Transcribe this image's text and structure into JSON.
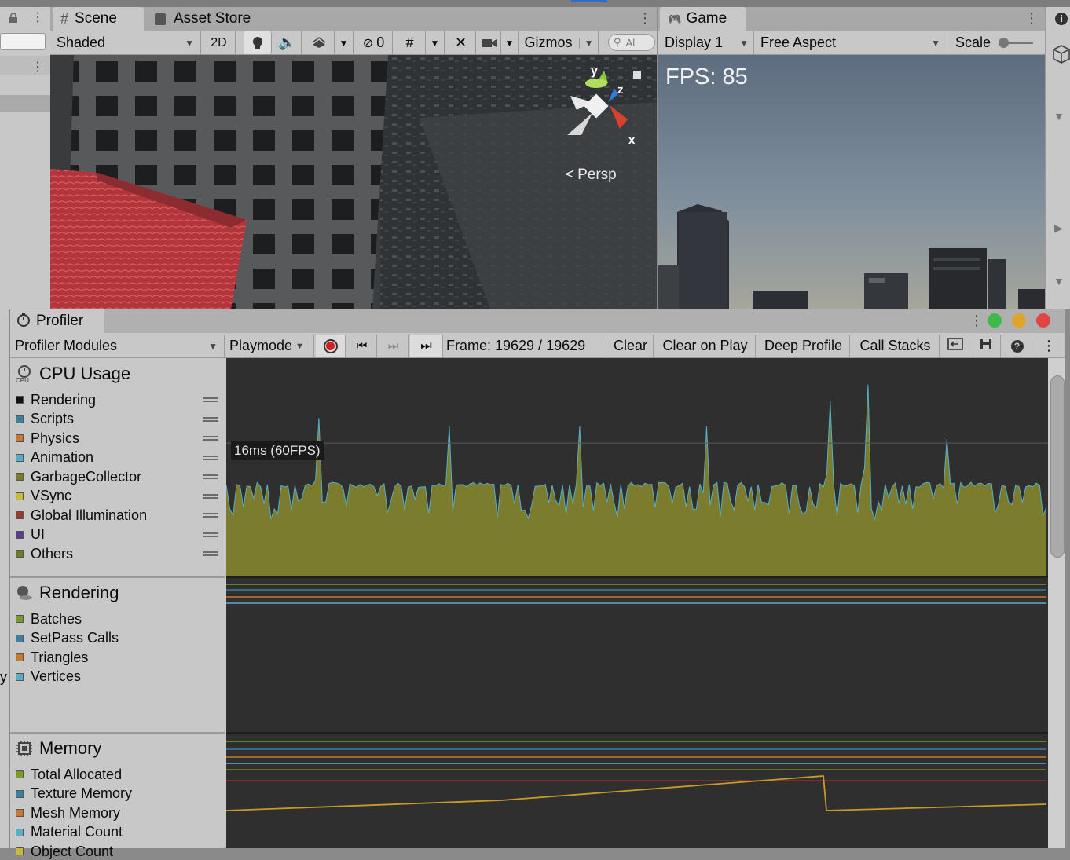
{
  "left_panel": {
    "lock_icon": "lock-icon",
    "menu_icon": "kebab-menu-icon"
  },
  "scene": {
    "tabs": [
      {
        "label": "Scene",
        "icon": "hash-icon"
      },
      {
        "label": "Asset Store",
        "icon": "shopping-bag-icon"
      }
    ],
    "toolbar": {
      "shading_mode": "Shaded",
      "toggle_2d": "2D",
      "hidden_count": "0",
      "gizmos": "Gizmos",
      "search_placeholder": "Al"
    },
    "gizmo": {
      "x": "x",
      "y": "y",
      "z": "z",
      "projection": "Persp"
    }
  },
  "game": {
    "tab_label": "Game",
    "display": "Display 1",
    "aspect": "Free Aspect",
    "scale_label": "Scale",
    "fps_overlay": "FPS: 85"
  },
  "profiler": {
    "tab_label": "Profiler",
    "modules_dropdown": "Profiler Modules",
    "target_dropdown": "Playmode",
    "frame": "Frame: 19629 / 19629",
    "buttons": {
      "clear": "Clear",
      "clear_on_play": "Clear on Play",
      "deep_profile": "Deep Profile",
      "call_stacks": "Call Stacks"
    },
    "window_colors": {
      "green": "#3fb94a",
      "yellow": "#e0a42a",
      "red": "#e04545"
    }
  },
  "modules": {
    "cpu": {
      "title": "CPU Usage",
      "icon": "cpu-icon",
      "items": [
        {
          "label": "Rendering",
          "color": "#111111"
        },
        {
          "label": "Scripts",
          "color": "#3c7fa1"
        },
        {
          "label": "Physics",
          "color": "#c47a30"
        },
        {
          "label": "Animation",
          "color": "#5aaec4"
        },
        {
          "label": "GarbageCollector",
          "color": "#7a7a2a"
        },
        {
          "label": "VSync",
          "color": "#c7b93a"
        },
        {
          "label": "Global Illumination",
          "color": "#9a3a2a"
        },
        {
          "label": "UI",
          "color": "#5a3c8a"
        },
        {
          "label": "Others",
          "color": "#6e7a28"
        }
      ]
    },
    "rendering": {
      "title": "Rendering",
      "icon": "rendering-sphere-icon",
      "items": [
        {
          "label": "Batches",
          "color": "#7a9a2a"
        },
        {
          "label": "SetPass Calls",
          "color": "#3c7fa1"
        },
        {
          "label": "Triangles",
          "color": "#c47a30"
        },
        {
          "label": "Vertices",
          "color": "#5aaec4"
        }
      ]
    },
    "memory": {
      "title": "Memory",
      "icon": "memory-chip-icon",
      "items": [
        {
          "label": "Total Allocated",
          "color": "#7a9a2a"
        },
        {
          "label": "Texture Memory",
          "color": "#3c7fa1"
        },
        {
          "label": "Mesh Memory",
          "color": "#c47a30"
        },
        {
          "label": "Material Count",
          "color": "#5aaec4"
        },
        {
          "label": "Object Count",
          "color": "#c7b93a"
        }
      ]
    }
  },
  "chart_data": {
    "type": "area",
    "title": "CPU Usage",
    "threshold_label": "16ms (60FPS)",
    "threshold_ms": 16,
    "ylim": [
      0,
      26
    ],
    "baseline_ms": 11,
    "spike_frames": [
      27,
      65,
      103,
      140,
      176,
      187,
      210
    ],
    "spike_ms": [
      19,
      18,
      18,
      18,
      21,
      23,
      16.5
    ]
  }
}
